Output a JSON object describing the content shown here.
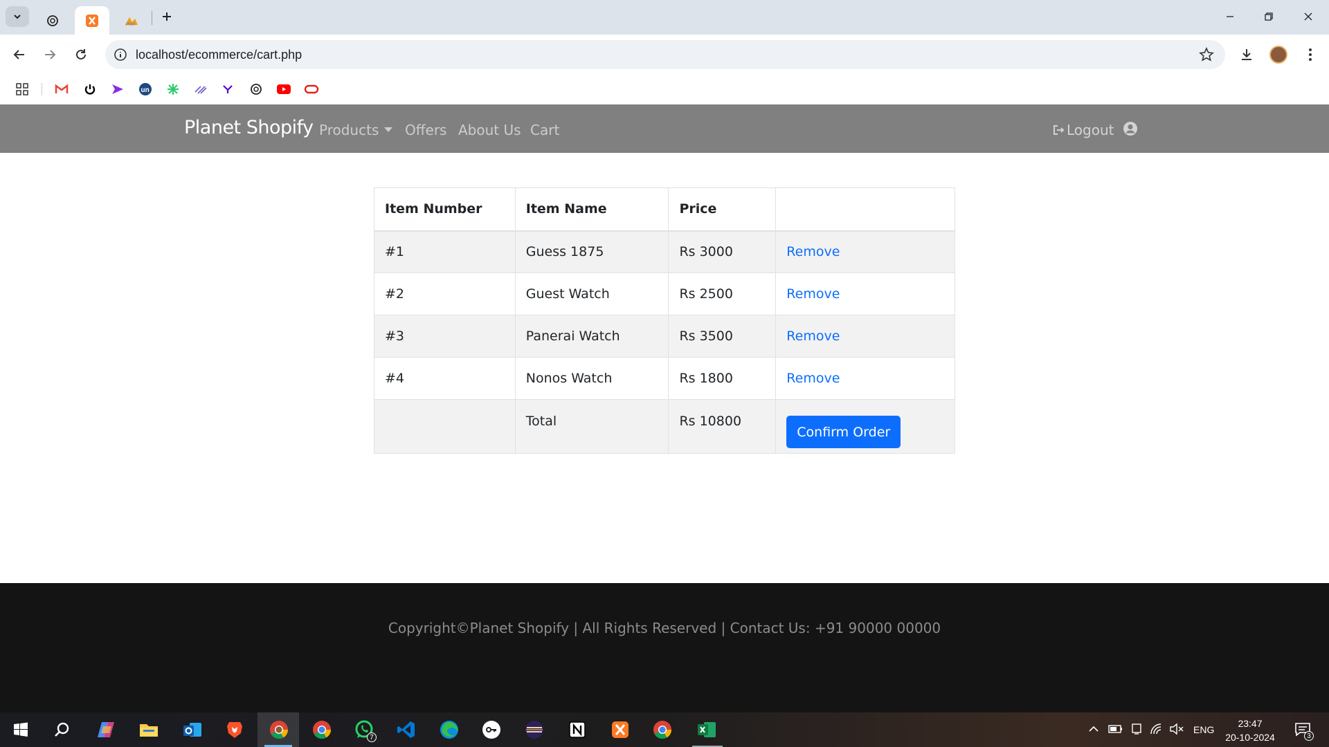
{
  "browser": {
    "url": "localhost/ecommerce/cart.php",
    "tabs": [
      {
        "name": "chatgpt-tab"
      },
      {
        "name": "xampp-tab",
        "active": true
      },
      {
        "name": "phpmyadmin-tab"
      }
    ]
  },
  "site": {
    "brand": "Planet Shopify",
    "nav": {
      "products": "Products",
      "offers": "Offers",
      "about": "About Us",
      "cart": "Cart",
      "logout": "Logout"
    }
  },
  "cart": {
    "headers": [
      "Item Number",
      "Item Name",
      "Price",
      ""
    ],
    "items": [
      {
        "number": "#1",
        "name": "Guess 1875",
        "price": "Rs 3000",
        "action": "Remove"
      },
      {
        "number": "#2",
        "name": "Guest Watch",
        "price": "Rs 2500",
        "action": "Remove"
      },
      {
        "number": "#3",
        "name": "Panerai Watch",
        "price": "Rs 3500",
        "action": "Remove"
      },
      {
        "number": "#4",
        "name": "Nonos Watch",
        "price": "Rs 1800",
        "action": "Remove"
      }
    ],
    "total_label": "Total",
    "total_value": "Rs 10800",
    "confirm_label": "Confirm Order"
  },
  "footer": {
    "text": "Copyright©Planet Shopify | All Rights Reserved | Contact Us: +91 90000 00000"
  },
  "taskbar": {
    "whatsapp_badge": "7",
    "notification_badge": "3",
    "language": "ENG",
    "time": "23:47",
    "date": "20-10-2024"
  },
  "colors": {
    "nav_bg": "#808080",
    "link_blue": "#0d6efd",
    "footer_bg": "#141414"
  }
}
